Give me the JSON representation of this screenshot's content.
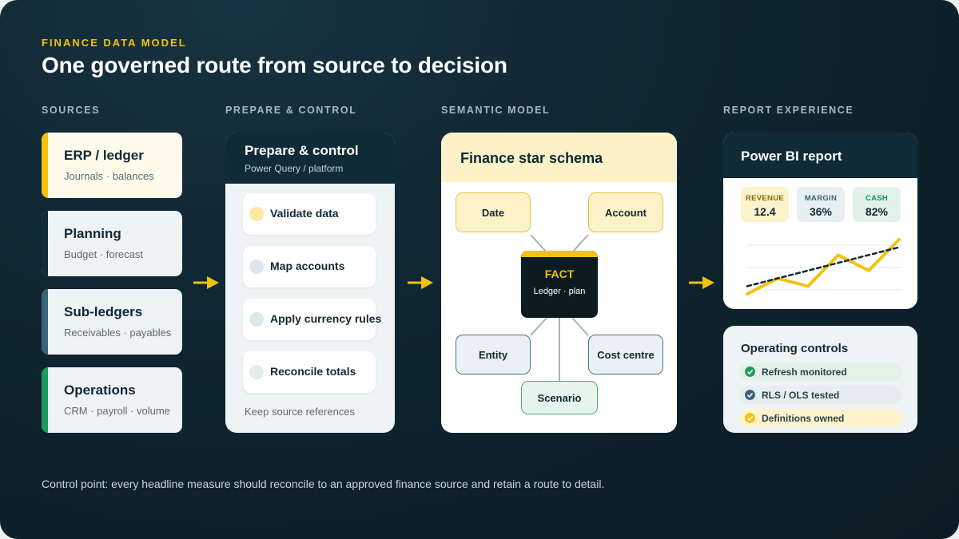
{
  "header": {
    "eyebrow": "FINANCE DATA MODEL",
    "title": "One governed route from source to decision"
  },
  "columns": {
    "sources": "SOURCES",
    "prepare": "PREPARE & CONTROL",
    "semantic": "SEMANTIC MODEL",
    "report": "REPORT EXPERIENCE"
  },
  "sources": [
    {
      "name": "ERP / ledger",
      "detail": "Journals · balances",
      "accent": "#f2c20f",
      "bg": "#fffbeb"
    },
    {
      "name": "Planning",
      "detail": "Budget · forecast",
      "accent": "#102b37",
      "bg": "#eef3f5"
    },
    {
      "name": "Sub-ledgers",
      "detail": "Receivables · payables",
      "accent": "#3a6478",
      "bg": "#eef3f5"
    },
    {
      "name": "Operations",
      "detail": "CRM · payroll · volume",
      "accent": "#1a9a5b",
      "bg": "#eef3f5"
    }
  ],
  "prepare": {
    "title": "Prepare & control",
    "subtitle": "Power Query / platform",
    "steps": [
      {
        "label": "Validate data",
        "dot": "#fbe9a4"
      },
      {
        "label": "Map accounts",
        "dot": "#dde6ec"
      },
      {
        "label": "Apply currency rules",
        "dot": "#dbe8ee"
      },
      {
        "label": "Reconcile totals",
        "dot": "#dff0e6"
      }
    ],
    "footer": "Keep source references"
  },
  "semantic": {
    "title": "Finance star schema",
    "fact": {
      "title": "FACT",
      "subtitle": "Ledger · plan"
    },
    "dimensions": {
      "date": "Date",
      "account": "Account",
      "entity": "Entity",
      "cost_centre": "Cost centre",
      "scenario": "Scenario"
    }
  },
  "report": {
    "title": "Power BI report",
    "kpis": [
      {
        "label": "REVENUE",
        "value": "12.4",
        "bg": "#fdf3cc",
        "color": "#8a6d00"
      },
      {
        "label": "MARGIN",
        "value": "36%",
        "bg": "#e6eef2",
        "color": "#3a6478"
      },
      {
        "label": "CASH",
        "value": "82%",
        "bg": "#e2f2e9",
        "color": "#1a8f55"
      }
    ],
    "chart_data": {
      "type": "line",
      "series": [
        {
          "values": [
            1,
            3,
            2,
            6,
            4,
            8
          ]
        },
        {
          "values": [
            2,
            3,
            4,
            5,
            6,
            7
          ]
        }
      ],
      "grid": true
    }
  },
  "controls": {
    "title": "Operating controls",
    "items": [
      {
        "label": "Refresh monitored",
        "icon": "check-icon",
        "color": "#1a9a5b",
        "bg": "#e4f2ea"
      },
      {
        "label": "RLS / OLS tested",
        "icon": "check-icon",
        "color": "#3a6478",
        "bg": "#e6eef2"
      },
      {
        "label": "Definitions owned",
        "icon": "check-icon",
        "color": "#f2c20f",
        "bg": "#fdf3cc"
      }
    ]
  },
  "footnote": "Control point: every headline measure should reconcile to an approved finance source and retain a route to detail.",
  "theme": {
    "accent": "#f2c20f",
    "dark": "#102b37",
    "green": "#1a9a5b"
  }
}
